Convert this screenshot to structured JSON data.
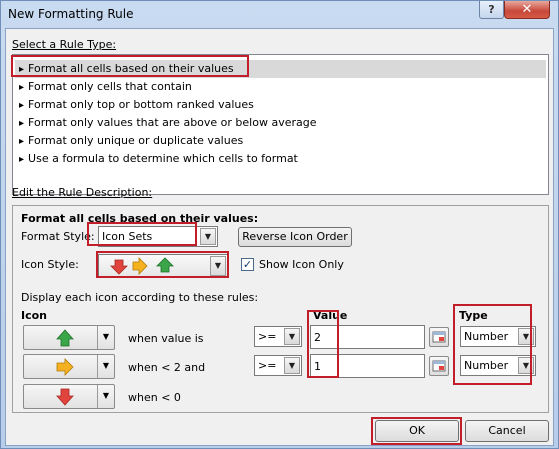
{
  "window": {
    "title": "New Formatting Rule",
    "help": "?",
    "close": "✕"
  },
  "select_rule": {
    "label": "Select a Rule Type:",
    "items": [
      "Format all cells based on their values",
      "Format only cells that contain",
      "Format only top or bottom ranked values",
      "Format only values that are above or below average",
      "Format only unique or duplicate values",
      "Use a formula to determine which cells to format"
    ],
    "selected_index": 0
  },
  "edit": {
    "label": "Edit the Rule Description:",
    "heading": "Format all cells based on their values:",
    "format_style_label": "Format Style:",
    "format_style_value": "Icon Sets",
    "reverse_button": "Reverse Icon Order",
    "icon_style_label": "Icon Style:",
    "show_icon_only_label": "Show Icon Only",
    "show_icon_only_checked": "✓",
    "display_rules_label": "Display each icon according to these rules:",
    "icon_header": "Icon",
    "value_header": "Value",
    "type_header": "Type",
    "rows": [
      {
        "icon": "green-up-arrow",
        "condition": "when value is",
        "operator": ">=",
        "value": "2",
        "type": "Number"
      },
      {
        "icon": "yellow-right-arrow",
        "condition": "when < 2 and",
        "operator": ">=",
        "value": "1",
        "type": "Number"
      },
      {
        "icon": "red-down-arrow",
        "condition": "when < 0"
      }
    ]
  },
  "buttons": {
    "ok": "OK",
    "cancel": "Cancel"
  },
  "colors": {
    "highlight": "#c21e2a",
    "green": "#3aa648",
    "yellow": "#f5b120",
    "red": "#e0443d"
  }
}
